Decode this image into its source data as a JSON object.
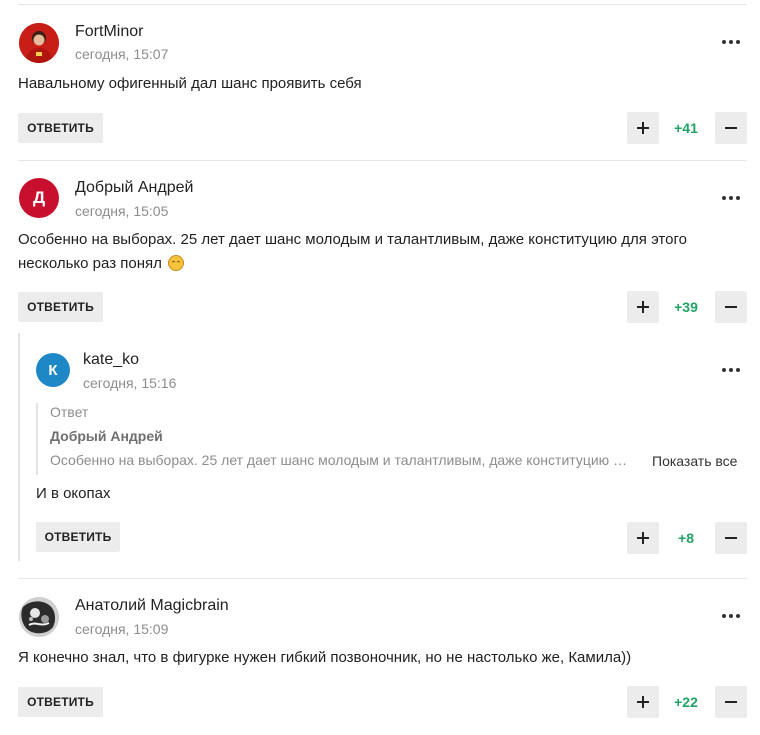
{
  "comments": [
    {
      "author": "FortMinor",
      "time": "сегодня, 15:07",
      "text": "Навальному офигенный дал шанс проявить себя",
      "reply_label": "ОТВЕТИТЬ",
      "score": "+41",
      "avatar_color": "#d7261e"
    },
    {
      "author": "Добрый Андрей",
      "time": "сегодня, 15:05",
      "text_line1": "Особенно на выборах. 25 лет дает шанс молодым и талантливым, даже конституцию для этого",
      "text_line2": "несколько раз понял",
      "emoji": "smirk-emoji",
      "reply_label": "ОТВЕТИТЬ",
      "score": "+39",
      "avatar_letter": "Д",
      "avatar_color": "#c8102e"
    },
    {
      "author": "kate_ko",
      "time": "сегодня, 15:16",
      "quote_label": "Ответ",
      "quote_author": "Добрый Андрей",
      "quote_text": "Особенно на выборах. 25 лет дает шанс молодым и талантливым, даже конституцию …",
      "show_all": "Показать все",
      "text": "И в окопах",
      "reply_label": "ОТВЕТИТЬ",
      "score": "+8",
      "avatar_letter": "К",
      "avatar_color": "#1e88c7"
    },
    {
      "author": "Анатолий Magicbrain",
      "time": "сегодня, 15:09",
      "text": "Я конечно знал, что в фигурке нужен гибкий позвоночник, но не настолько же, Камила))",
      "reply_label": "ОТВЕТИТЬ",
      "score": "+22"
    }
  ],
  "colors": {
    "score_positive": "#21a366",
    "button_bg": "#ececec",
    "meta_gray": "#8c8c8c"
  }
}
